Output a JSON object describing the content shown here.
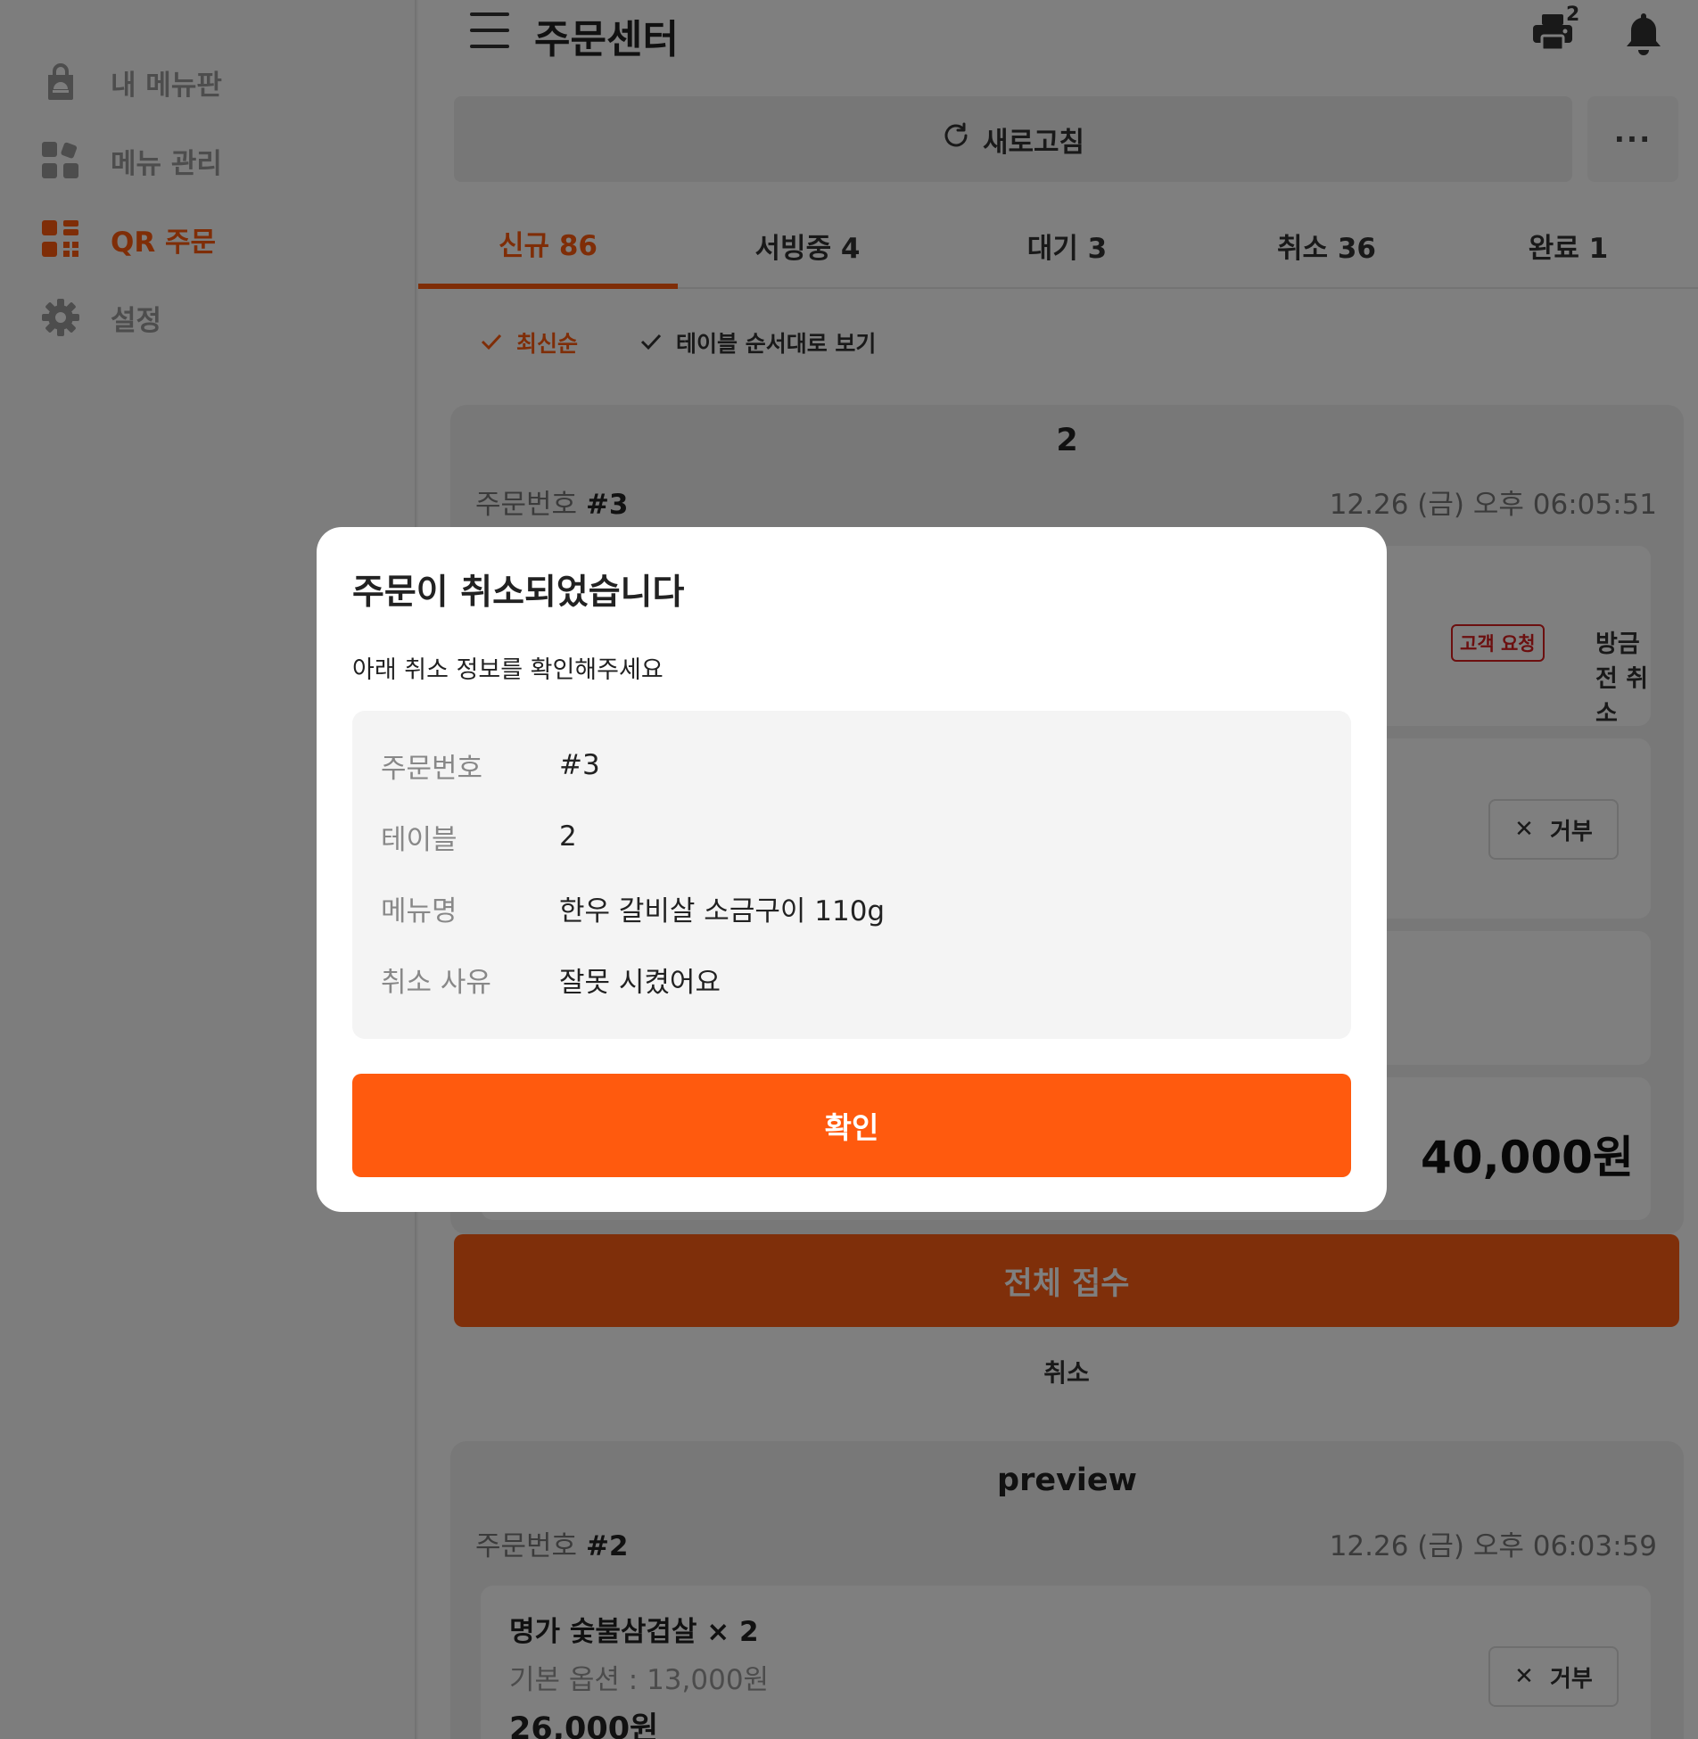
{
  "sidebar": {
    "items": [
      {
        "label": "내 메뉴판",
        "icon": "bag-icon",
        "active": false
      },
      {
        "label": "메뉴 관리",
        "icon": "grid-icon",
        "active": false
      },
      {
        "label": "QR 주문",
        "icon": "qr-icon",
        "active": true
      },
      {
        "label": "설정",
        "icon": "gear-icon",
        "active": false
      }
    ]
  },
  "header": {
    "title": "주문센터",
    "printer_count": "2"
  },
  "toolbar": {
    "refresh_label": "새로고침",
    "more_label": "···"
  },
  "tabs": [
    {
      "label": "신규 86",
      "active": true
    },
    {
      "label": "서빙중 4",
      "active": false
    },
    {
      "label": "대기 3",
      "active": false
    },
    {
      "label": "취소 36",
      "active": false
    },
    {
      "label": "완료 1",
      "active": false
    }
  ],
  "sort": {
    "latest": "최신순",
    "by_table": "테이블 순서대로 보기"
  },
  "orders": [
    {
      "table": "2",
      "order_no_label": "주문번호",
      "order_no": "#3",
      "time": "12.26 (금) 오후 06:05:51",
      "request_tag": "고객 요청",
      "request_text": "방금 전 취소",
      "reject_label": "거부",
      "total": "40,000원",
      "accept_label": "전체 접수",
      "cancel_label": "취소"
    },
    {
      "table": "preview",
      "order_no_label": "주문번호",
      "order_no": "#2",
      "time": "12.26 (금) 오후 06:03:59",
      "item_name": "명가 숯불삼겹살 × 2",
      "item_option": "기본 옵션 : 13,000원",
      "item_price": "26,000원",
      "reject_label": "거부"
    }
  ],
  "modal": {
    "title": "주문이 취소되었습니다",
    "subtitle": "아래 취소 정보를 확인해주세요",
    "rows": [
      {
        "label": "주문번호",
        "value": "#3"
      },
      {
        "label": "테이블",
        "value": "2"
      },
      {
        "label": "메뉴명",
        "value": "한우 갈비살 소금구이 110g"
      },
      {
        "label": "취소 사유",
        "value": "잘못 시켰어요"
      }
    ],
    "confirm_label": "확인"
  },
  "colors": {
    "accent": "#ff5a0e",
    "danger": "#d81f1f"
  }
}
